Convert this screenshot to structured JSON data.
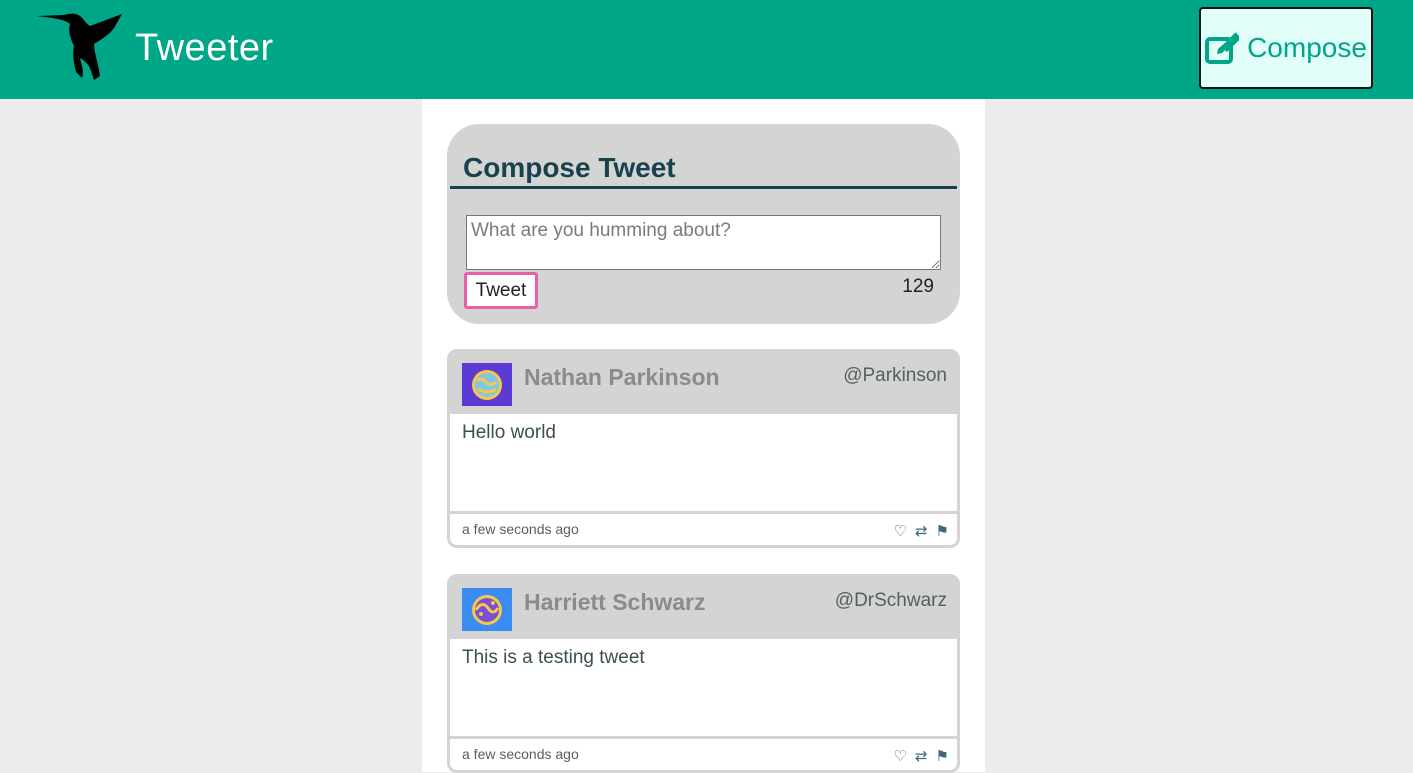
{
  "header": {
    "app_name": "Tweeter",
    "compose_label": "Compose",
    "brand_color": "#00a688"
  },
  "compose": {
    "title": "Compose Tweet",
    "placeholder": "What are you humming about?",
    "value": "",
    "submit_label": "Tweet",
    "char_count": "129"
  },
  "tweets": [
    {
      "name": "Nathan Parkinson",
      "handle": "@Parkinson",
      "text": "Hello world",
      "time": "a few seconds ago",
      "avatar_color": "#5b3bd3"
    },
    {
      "name": "Harriett Schwarz",
      "handle": "@DrSchwarz",
      "text": "This is a testing tweet",
      "time": "a few seconds ago",
      "avatar_color": "#3a8cf2"
    }
  ],
  "icons": {
    "like": "heart-outline",
    "retweet": "retweet-arrows",
    "flag": "flag",
    "compose": "edit-square",
    "logo": "hummingbird-silhouette"
  }
}
